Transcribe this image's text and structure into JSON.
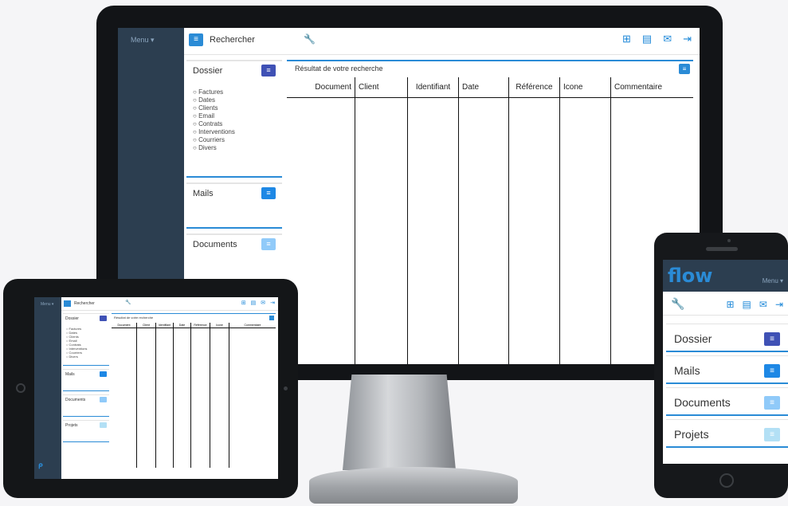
{
  "desktop": {
    "sidebar": {
      "menu_label": "Menu ▾"
    },
    "topbar": {
      "search_label": "Rechercher",
      "icons": [
        "add-icon",
        "documents-icon",
        "mail-icon",
        "logout-icon"
      ]
    },
    "panels": [
      {
        "title": "Dossier",
        "options": [
          "Factures",
          "Dates",
          "Clients",
          "Email",
          "Contrats",
          "Interventions",
          "Courriers",
          "Divers"
        ]
      },
      {
        "title": "Mails"
      },
      {
        "title": "Documents"
      }
    ],
    "results": {
      "title": "Résultat de votre recherche",
      "columns": [
        "Document",
        "Client",
        "Identifiant",
        "Date",
        "Référence",
        "Icone",
        "Commentaire"
      ]
    }
  },
  "tablet": {
    "search_label": "Rechercher",
    "menu_label": "Menu ▾",
    "panels": [
      {
        "title": "Dossier",
        "options": [
          "Factures",
          "Dates",
          "Clients",
          "Email",
          "Contrats",
          "Interventions",
          "Courriers",
          "Divers"
        ]
      },
      {
        "title": "Mails"
      },
      {
        "title": "Documents"
      },
      {
        "title": "Projets"
      }
    ],
    "results_title": "Résultat de votre recherche",
    "columns": [
      "Document",
      "Client",
      "Identifiant",
      "Date",
      "Référence",
      "Icone",
      "Commentaire"
    ]
  },
  "phone": {
    "logo": "flow",
    "menu_label": "Menu ▾",
    "panels": [
      {
        "title": "Dossier"
      },
      {
        "title": "Mails"
      },
      {
        "title": "Documents"
      },
      {
        "title": "Projets"
      }
    ]
  },
  "colors": {
    "accent": "#2a8bd6",
    "sidebar": "#2c3e50",
    "dossier_btn": "#3f51b5",
    "mails_btn": "#1e88e5",
    "documents_btn": "#90caf9",
    "projets_btn": "#b3e0f5"
  }
}
